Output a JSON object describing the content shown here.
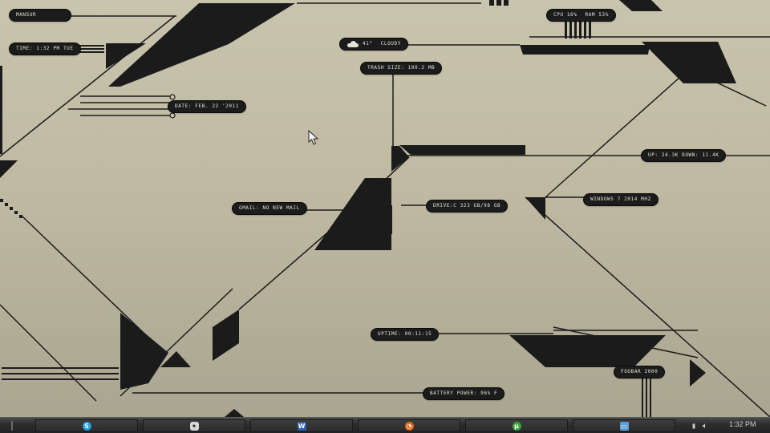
{
  "widgets": {
    "username": "MANSUR",
    "time": "TIME: 1:32 PM TUE",
    "weather_temp": "41°",
    "weather_cond": "CLOUDY",
    "trash": "TRASH SIZE: 100.2 MB",
    "cpu": "CPU 16%",
    "ram": "RAM 53%",
    "date": "DATE: FEB. 22 '2011",
    "network": "UP: 24.3K DOWN: 11.4K",
    "os": "WINDOWS 7 2014 MHZ",
    "gmail": "GMAIL: NO NEW MAIL",
    "drive": "DRIVE:C 323 GB/98 GB",
    "uptime": "UPTIME: 00:11:15",
    "foobar": "FOOBAR 2000",
    "battery": "BATTERY POWER: 96% F"
  },
  "taskbar": {
    "buttons": [
      {
        "name": "skype",
        "icon": "skype-icon",
        "color": "#1e9fdf"
      },
      {
        "name": "ninja",
        "icon": "ninja-icon",
        "color": "#d8d8d8"
      },
      {
        "name": "word",
        "icon": "word-icon",
        "color": "#2b5fb3"
      },
      {
        "name": "firefox",
        "icon": "firefox-icon",
        "color": "#e06b1a"
      },
      {
        "name": "utorrent",
        "icon": "utorrent-icon",
        "color": "#3aa33a"
      },
      {
        "name": "computer",
        "icon": "monitor-icon",
        "color": "#5aa0d8"
      }
    ],
    "clock": "1:32 PM"
  }
}
